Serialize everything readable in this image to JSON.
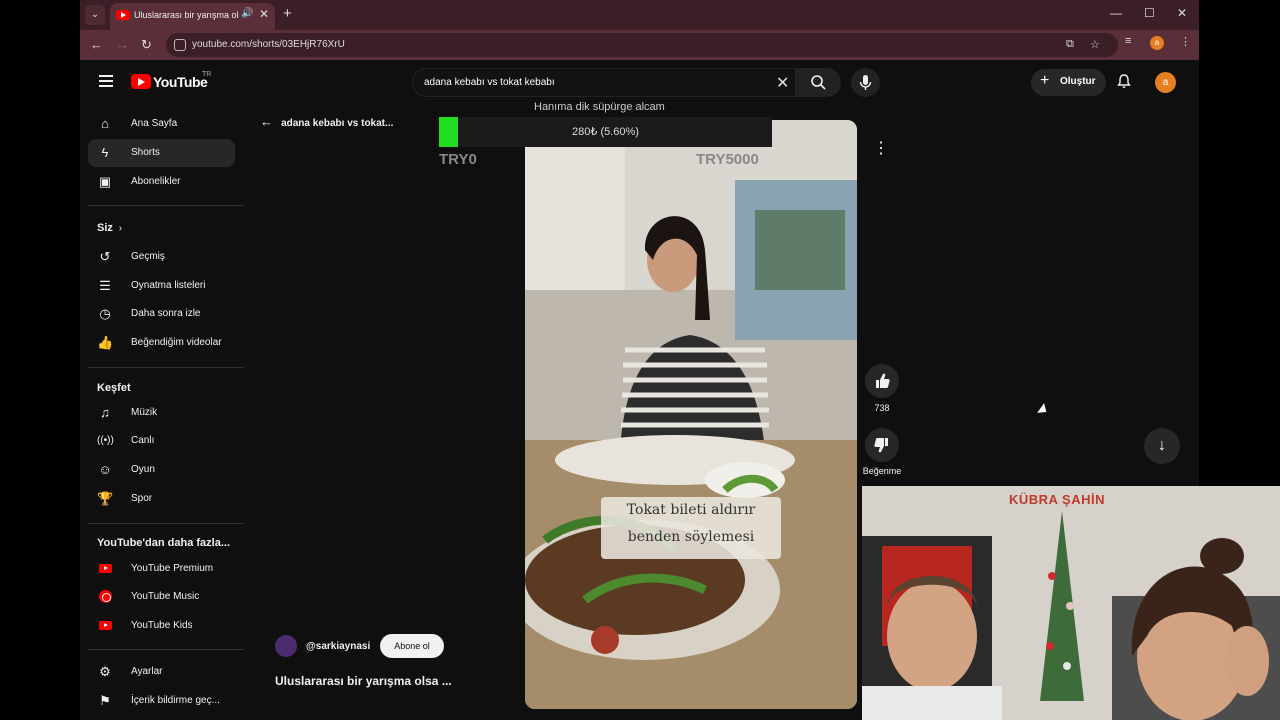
{
  "browser": {
    "tab_title": "Uluslararası bir yarışma olsa",
    "url": "youtube.com/shorts/03EHjR76XrU",
    "profile_initial": "a"
  },
  "youtube": {
    "logo_text": "YouTube",
    "region": "TR",
    "search_query": "adana kebabı vs tokat kebabı",
    "create_label": "Oluştur",
    "avatar_initial": "a"
  },
  "sidebar": {
    "main": [
      {
        "label": "Ana Sayfa",
        "icon": "home-icon"
      },
      {
        "label": "Shorts",
        "icon": "shorts-icon",
        "active": true
      },
      {
        "label": "Abonelikler",
        "icon": "subscriptions-icon"
      }
    ],
    "you_heading": "Siz",
    "you": [
      {
        "label": "Geçmiş",
        "icon": "history-icon"
      },
      {
        "label": "Oynatma listeleri",
        "icon": "playlist-icon"
      },
      {
        "label": "Daha sonra izle",
        "icon": "clock-icon"
      },
      {
        "label": "Beğendiğim videolar",
        "icon": "thumb-up-icon"
      }
    ],
    "explore_heading": "Keşfet",
    "explore": [
      {
        "label": "Müzik",
        "icon": "music-icon"
      },
      {
        "label": "Canlı",
        "icon": "live-icon"
      },
      {
        "label": "Oyun",
        "icon": "game-icon"
      },
      {
        "label": "Spor",
        "icon": "trophy-icon"
      }
    ],
    "more_heading": "YouTube'dan daha fazla...",
    "more": [
      {
        "label": "YouTube Premium",
        "icon": "youtube-premium-icon"
      },
      {
        "label": "YouTube Music",
        "icon": "youtube-music-icon"
      },
      {
        "label": "YouTube Kids",
        "icon": "youtube-kids-icon"
      }
    ],
    "bottom": [
      {
        "label": "Ayarlar",
        "icon": "settings-icon"
      },
      {
        "label": "İçerik bildirme geç...",
        "icon": "flag-icon"
      }
    ]
  },
  "shorts": {
    "back_query": "adana kebabı vs tokat...",
    "caption_line1": "Tokat bileti aldırır",
    "caption_line2": "benden söylemesi",
    "like_count": "738",
    "dislike_label": "Beğenme",
    "channel": "@sarkiaynasi",
    "subscribe_label": "Abone ol",
    "title": "Uluslararası bir yarışma olsa ..."
  },
  "donation_overlay": {
    "wish": "Hanıma dik süpürge alcam",
    "progress_text": "280₺ (5.60%)",
    "progress_fraction": 0.056,
    "left_label": "TRY0",
    "right_label": "TRY5000"
  },
  "webcam": {
    "name": "KÜBRA ŞAHİN"
  },
  "colors": {
    "accent": "#ff0000",
    "progress": "#22dd22",
    "browser_frame": "#5a2f3a"
  }
}
